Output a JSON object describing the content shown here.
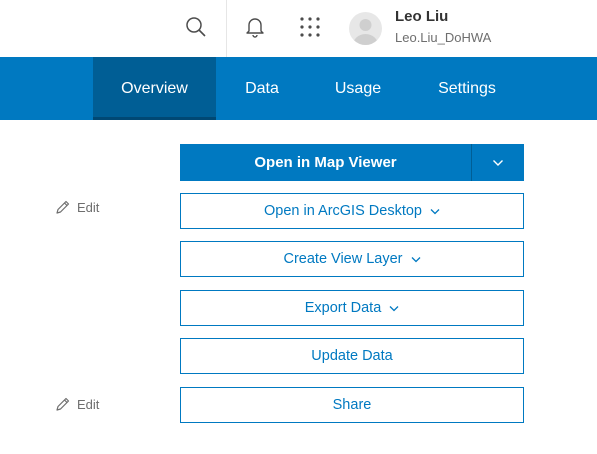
{
  "user": {
    "name": "Leo Liu",
    "username": "Leo.Liu_DoHWA"
  },
  "icons": {
    "search": "search-icon",
    "notifications": "bell-icon",
    "apps": "grid-icon",
    "avatar": "user-avatar-icon"
  },
  "nav": {
    "tabs": [
      {
        "label": "Overview",
        "active": true
      },
      {
        "label": "Data",
        "active": false
      },
      {
        "label": "Usage",
        "active": false
      },
      {
        "label": "Settings",
        "active": false
      }
    ]
  },
  "edit_links": [
    {
      "label": "Edit"
    },
    {
      "label": "Edit"
    }
  ],
  "actions": {
    "open_map_viewer": "Open in Map Viewer",
    "open_arcgis_desktop": "Open in ArcGIS Desktop",
    "create_view_layer": "Create View Layer",
    "export_data": "Export Data",
    "update_data": "Update Data",
    "share": "Share"
  },
  "colors": {
    "brand": "#0079c1",
    "brand_dark": "#005e95",
    "text_muted": "#6e6e6e"
  }
}
